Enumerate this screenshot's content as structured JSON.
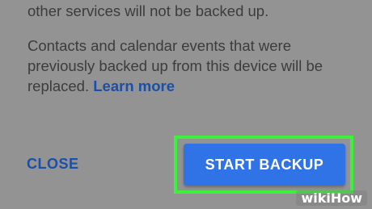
{
  "dialog": {
    "text_line_1": "other services will not be backed up.",
    "text_para_2": "Contacts and calendar events that were previously backed up from this device will be replaced.",
    "learn_more_label": "Learn more",
    "close_label": "CLOSE",
    "start_backup_label": "START BACKUP"
  },
  "watermark": {
    "wiki": "wiki",
    "how": "How"
  },
  "colors": {
    "accent": "#2f73e6",
    "link": "#1b4fa8",
    "highlight": "#3cf03c",
    "overlay": "#939393"
  }
}
